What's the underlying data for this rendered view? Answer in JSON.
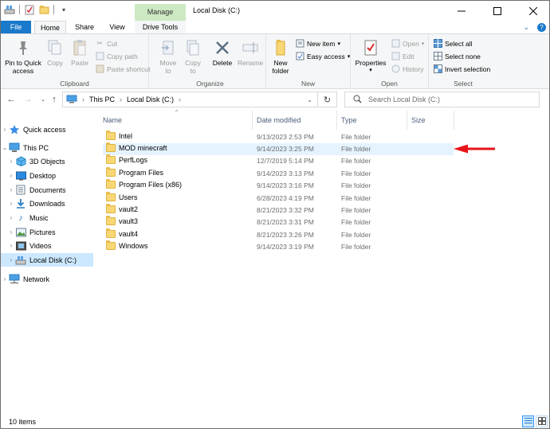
{
  "window": {
    "title": "Local Disk (C:)"
  },
  "contextual_tab": {
    "group": "Manage",
    "tab": "Drive Tools"
  },
  "tabs": [
    "File",
    "Home",
    "Share",
    "View",
    "Drive Tools"
  ],
  "ribbon": {
    "clipboard": {
      "label": "Clipboard",
      "pin": "Pin to Quick access",
      "pin_line1": "Pin to Quick",
      "pin_line2": "access",
      "copy": "Copy",
      "paste": "Paste",
      "cut": "Cut",
      "copy_path": "Copy path",
      "paste_shortcut": "Paste shortcut"
    },
    "organize": {
      "label": "Organize",
      "move_to": "Move",
      "copy_to": "Copy",
      "to": "to",
      "delete": "Delete",
      "rename": "Rename"
    },
    "new": {
      "label": "New",
      "new_folder_line1": "New",
      "new_folder_line2": "folder",
      "new_item": "New item",
      "easy_access": "Easy access"
    },
    "open": {
      "label": "Open",
      "properties": "Properties",
      "open": "Open",
      "edit": "Edit",
      "history": "History"
    },
    "select": {
      "label": "Select",
      "select_all": "Select all",
      "select_none": "Select none",
      "invert": "Invert selection"
    }
  },
  "address": {
    "crumbs": [
      "This PC",
      "Local Disk (C:)"
    ],
    "search_placeholder": "Search Local Disk (C:)"
  },
  "nav": {
    "quick_access": "Quick access",
    "this_pc": "This PC",
    "items": [
      "3D Objects",
      "Desktop",
      "Documents",
      "Downloads",
      "Music",
      "Pictures",
      "Videos",
      "Local Disk (C:)"
    ],
    "network": "Network"
  },
  "columns": [
    "Name",
    "Date modified",
    "Type",
    "Size"
  ],
  "files": [
    {
      "name": "Intel",
      "date": "9/13/2023 2:53 PM",
      "type": "File folder"
    },
    {
      "name": "MOD minecraft",
      "date": "9/14/2023 3:25 PM",
      "type": "File folder"
    },
    {
      "name": "PerfLogs",
      "date": "12/7/2019 5:14 PM",
      "type": "File folder"
    },
    {
      "name": "Program Files",
      "date": "9/14/2023 3:13 PM",
      "type": "File folder"
    },
    {
      "name": "Program Files (x86)",
      "date": "9/14/2023 3:16 PM",
      "type": "File folder"
    },
    {
      "name": "Users",
      "date": "6/28/2023 4:19 PM",
      "type": "File folder"
    },
    {
      "name": "vault2",
      "date": "8/21/2023 3:32 PM",
      "type": "File folder"
    },
    {
      "name": "vault3",
      "date": "8/21/2023 3:31 PM",
      "type": "File folder"
    },
    {
      "name": "vault4",
      "date": "8/21/2023 3:26 PM",
      "type": "File folder"
    },
    {
      "name": "Windows",
      "date": "9/14/2023 3:19 PM",
      "type": "File folder"
    }
  ],
  "status": {
    "count": "10 items"
  },
  "colors": {
    "accent": "#1979ca",
    "selection": "#cce8ff",
    "manage": "#cde9c4",
    "annotation_arrow": "#e8141b"
  }
}
